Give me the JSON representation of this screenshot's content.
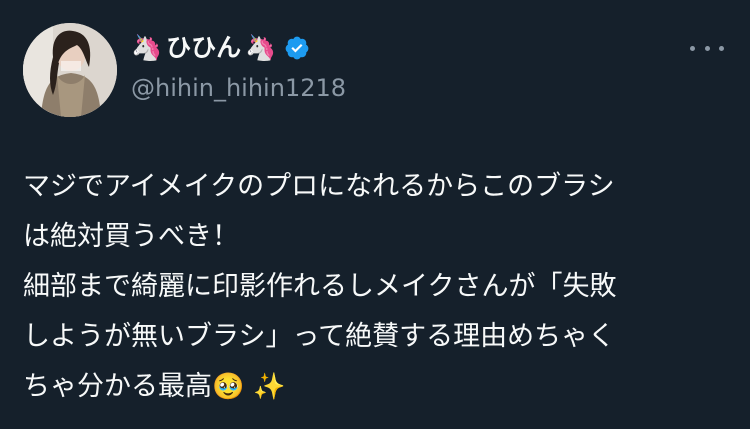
{
  "author": {
    "name_prefix_emoji": "🦄",
    "display_name": "ひひん",
    "name_suffix_emoji": "🦄",
    "handle": "@hihin_hihin1218",
    "verified": true,
    "verified_color": "#1d9bf0"
  },
  "post": {
    "lines": [
      "マジでアイメイクのプロになれるからこのブラシ",
      "は絶対買うべき！",
      "細部まで綺麗に印影作れるしメイクさんが「失敗",
      "しようが無いブラシ」って絶賛する理由めちゃく",
      "ちゃ分かる最高"
    ],
    "trailing_emojis": [
      "🥹",
      "✨"
    ]
  },
  "theme": {
    "background": "#15202b",
    "text": "#f7f9f9",
    "muted": "#8b98a5"
  },
  "icons": {
    "more": "more-horizontal-icon",
    "verified": "verified-badge-icon"
  }
}
